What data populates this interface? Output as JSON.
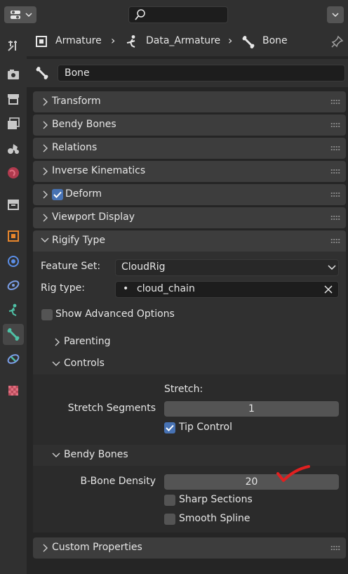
{
  "breadcrumb": {
    "object": "Armature",
    "data": "Data_Armature",
    "bone": "Bone"
  },
  "bone_name": "Bone",
  "panels": {
    "transform": "Transform",
    "bendy_bones": "Bendy Bones",
    "relations": "Relations",
    "inverse_kinematics": "Inverse Kinematics",
    "deform": "Deform",
    "viewport_display": "Viewport Display",
    "rigify_type": "Rigify Type",
    "custom_properties": "Custom Properties"
  },
  "rigify": {
    "feature_set_label": "Feature Set:",
    "feature_set_value": "CloudRig",
    "rig_type_label": "Rig type:",
    "rig_type_value": "cloud_chain",
    "show_advanced": "Show Advanced Options",
    "parenting": "Parenting",
    "controls": "Controls",
    "stretch_header": "Stretch:",
    "stretch_segments_label": "Stretch Segments",
    "stretch_segments_value": "1",
    "tip_control": "Tip Control",
    "bendy_bones": "Bendy Bones",
    "bbone_density_label": "B-Bone Density",
    "bbone_density_value": "20",
    "sharp_sections": "Sharp Sections",
    "smooth_spline": "Smooth Spline"
  },
  "colors": {
    "accent": "#4772b3",
    "active_tab_icon": "#4fc1a6",
    "annotation": "#e02020"
  }
}
